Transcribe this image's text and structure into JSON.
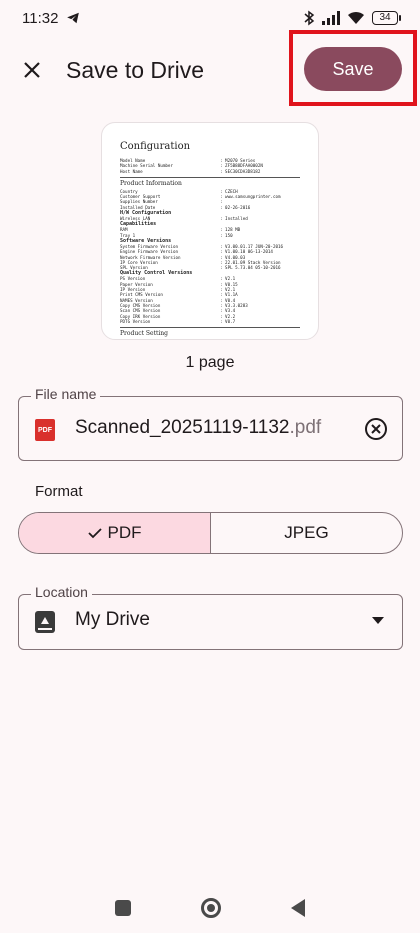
{
  "status_bar": {
    "time": "11:32",
    "battery": "34"
  },
  "app_bar": {
    "title": "Save to Drive",
    "save_label": "Save"
  },
  "preview": {
    "doc_title": "Configuration",
    "header_rows": [
      {
        "k": "Model Name",
        "v": ": M2070 Series"
      },
      {
        "k": "Machine Serial Number",
        "v": ": ZF5B88DFAA0002N"
      },
      {
        "k": "Host Name",
        "v": ": SEC30CDA3D8182"
      }
    ],
    "section_title": "Product Information",
    "rows": [
      {
        "k": "Country",
        "v": ": CZECH",
        "bold": false
      },
      {
        "k": "Customer Support",
        "v": ": www.samsungprinter.com",
        "bold": false
      },
      {
        "k": "Supplies Number",
        "v": ":",
        "bold": false
      },
      {
        "k": "Installed Date",
        "v": ": 02-26-2016",
        "bold": false
      },
      {
        "k": "H/W Configuration",
        "v": "",
        "bold": true
      },
      {
        "k": "Wireless LAN",
        "v": ": Installed",
        "bold": false
      },
      {
        "k": "Capabilities",
        "v": "",
        "bold": true
      },
      {
        "k": "RAM",
        "v": ": 128 MB",
        "bold": false
      },
      {
        "k": "Tray 1",
        "v": ": 150",
        "bold": false
      },
      {
        "k": "Software Versions",
        "v": "",
        "bold": true
      },
      {
        "k": "System Firmware Version",
        "v": ": V3.00.01.17     JUN-20-2016",
        "bold": false
      },
      {
        "k": "Engine Firmware Version",
        "v": ": V1.00.10 06-13-2014",
        "bold": false
      },
      {
        "k": "Network Firmware Version",
        "v": ": V4.00.03",
        "bold": false
      },
      {
        "k": "IP Core Version",
        "v": ": 22.01.09 Stack Version",
        "bold": false
      },
      {
        "k": "SPL Version",
        "v": ": SPL 5.73.04 05-10-2016",
        "bold": false
      },
      {
        "k": "Quality Control Versions",
        "v": "",
        "bold": true
      },
      {
        "k": "PS Version",
        "v": ": V2.1",
        "bold": false
      },
      {
        "k": "Paper Version",
        "v": ": V0.15",
        "bold": false
      },
      {
        "k": "IP Version",
        "v": ": V2.1",
        "bold": false
      },
      {
        "k": "Print CMS Version",
        "v": ": V1.1A",
        "bold": false
      },
      {
        "k": "NAMES Version",
        "v": ": V0.4",
        "bold": false
      },
      {
        "k": "Copy CMS Version",
        "v": ": V3.3.0283",
        "bold": false
      },
      {
        "k": "Scan CMS Version",
        "v": ": V3.4",
        "bold": false
      },
      {
        "k": "Copy IRK Version",
        "v": ": V2.2",
        "bold": false
      },
      {
        "k": "PDTG Version",
        "v": ": V0.7",
        "bold": false
      }
    ],
    "footer_section": "Product Setting"
  },
  "page_count": "1 page",
  "file_name": {
    "label": "File name",
    "name": "Scanned_20251119-1132",
    "ext": ".pdf",
    "icon_text": "PDF"
  },
  "format": {
    "label": "Format",
    "options": [
      "PDF",
      "JPEG"
    ],
    "selected": "PDF"
  },
  "location": {
    "label": "Location",
    "value": "My Drive"
  },
  "colors": {
    "accent": "#8a4a5e",
    "selected_segment": "#fcd9e1",
    "highlight": "#e0141c"
  }
}
